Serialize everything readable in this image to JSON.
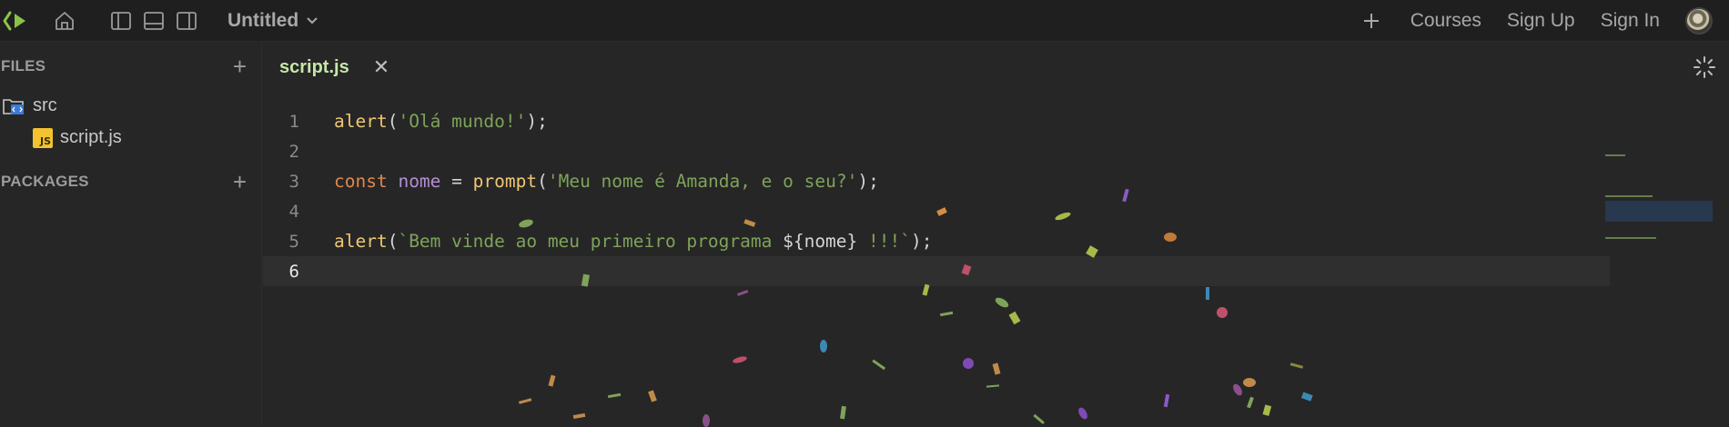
{
  "topbar": {
    "project_name": "Untitled",
    "links": {
      "courses": "Courses",
      "sign_up": "Sign Up",
      "sign_in": "Sign In"
    }
  },
  "sidebar": {
    "files_title": "FILES",
    "packages_title": "PACKAGES",
    "tree": [
      {
        "label": "src",
        "icon": "folder-code-icon"
      },
      {
        "label": "script.js",
        "icon": "js-file-icon",
        "badge": "JS"
      }
    ]
  },
  "editor": {
    "tab_label": "script.js",
    "lines": [
      {
        "number": "1"
      },
      {
        "number": "2"
      },
      {
        "number": "3"
      },
      {
        "number": "4"
      },
      {
        "number": "5"
      },
      {
        "number": "6"
      }
    ],
    "code": {
      "l1": {
        "fn": "alert",
        "open": "(",
        "str": "'Olá mundo!'",
        "close": ");"
      },
      "l3": {
        "kw": "const",
        "var": "nome",
        "eq": " = ",
        "fn": "prompt",
        "open": "(",
        "str": "'Meu nome é Amanda, e o seu?'",
        "close": ");"
      },
      "l5": {
        "fn": "alert",
        "open": "(",
        "str1": "`Bem vinde ao meu primeiro programa ",
        "interp": "${nome}",
        "str2": " !!!`",
        "close": ");"
      }
    },
    "active_line": 6
  },
  "colors": {
    "accent_green": "#8bc34a",
    "tab_text": "#c6e6a8",
    "function": "#f0c674",
    "keyword": "#e0874d",
    "variable": "#b48ed6",
    "string": "#7fa35a"
  }
}
